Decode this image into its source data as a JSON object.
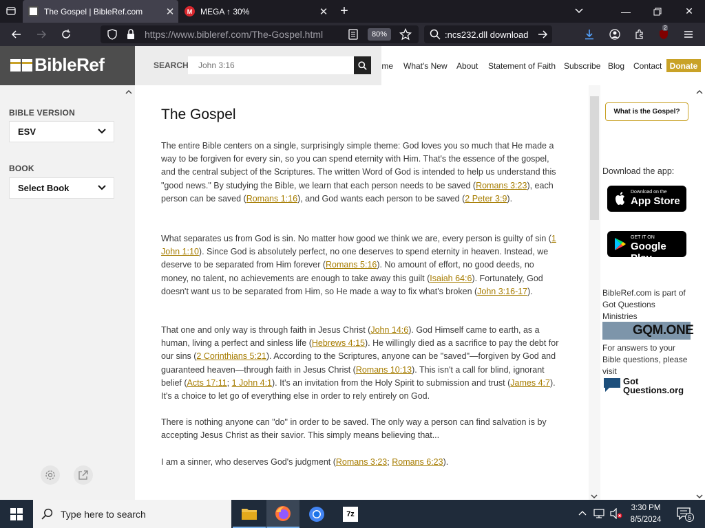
{
  "browser": {
    "tabs": [
      {
        "title": "The Gospel | BibleRef.com",
        "favicon": "bibleref-favicon",
        "active": true
      },
      {
        "title": "MEGA ↑ 30%",
        "favicon": "mega-favicon",
        "active": false
      }
    ],
    "url_domain": "https://www.bibleref.com",
    "url_path": "/The-Gospel.html",
    "zoom": "80%",
    "search_text": ":ncs232.dll download",
    "extension_badge": "2"
  },
  "site": {
    "logo": "BibleRef",
    "search_label": "SEARCH",
    "search_placeholder": "John 3:16",
    "nav": [
      "Home",
      "What's New",
      "About",
      "Statement of Faith",
      "Subscribe",
      "Blog",
      "Contact"
    ],
    "donate": "Donate",
    "accent_color": "#c9a227"
  },
  "sidebar": {
    "bible_version_label": "BIBLE VERSION",
    "bible_version_value": "ESV",
    "book_label": "BOOK",
    "book_value": "Select Book"
  },
  "article": {
    "title": "The Gospel",
    "p1": [
      "The entire Bible centers on a single, surprisingly simple theme: God loves you so much that He made a way to be forgiven for every sin, so you can spend eternity with Him. That's the essence of the gospel, and the central subject of the Scriptures. The written Word of God is intended to help us understand this \"good news.\" By studying the Bible, we learn that each person needs to be saved (",
      "Romans 3:23",
      "), each person can be saved (",
      "Romans 1:16",
      "), and God wants each person to be saved (",
      "2 Peter 3:9",
      ")."
    ],
    "p2": [
      "What separates us from God is sin. No matter how good we think we are, every person is guilty of sin (",
      "1 John 1:10",
      "). Since God is absolutely perfect, no one deserves to spend eternity in heaven. Instead, we deserve to be separated from Him forever (",
      "Romans 5:16",
      "). No amount of effort, no good deeds, no money, no talent, no achievements are enough to take away this guilt (",
      "Isaiah 64:6",
      "). Fortunately, God doesn't want us to be separated from Him, so He made a way to fix what's broken (",
      "John 3:16-17",
      ")."
    ],
    "p3": [
      "That one and only way is through faith in Jesus Christ (",
      "John 14:6",
      "). God Himself came to earth, as a human, living a perfect and sinless life (",
      "Hebrews 4:15",
      "). He willingly died as a sacrifice to pay the debt for our sins (",
      "2 Corinthians 5:21",
      "). According to the Scriptures, anyone can be \"saved\"—forgiven by God and guaranteed heaven—through faith in Jesus Christ (",
      "Romans 10:13",
      "). This isn't a call for blind, ignorant belief (",
      "Acts 17:11",
      "; ",
      "1 John 4:1",
      "). It's an invitation from the Holy Spirit to submission and trust (",
      "James 4:7",
      "). It's a choice to let go of everything else in order to rely entirely on God."
    ],
    "p4": "There is nothing anyone can \"do\" in order to be saved. The only way a person can find salvation is by accepting Jesus Christ as their savior. This simply means believing that...",
    "p5": [
      "I am a sinner, who deserves God's judgment (",
      "Romans 3:23",
      "; ",
      "Romans 6:23",
      ")."
    ]
  },
  "right": {
    "gospel_button": "What is the Gospel?",
    "download_label": "Download the app:",
    "appstore_small": "Download on the",
    "appstore_big": "App Store",
    "googleplay_small": "GET IT ON",
    "googleplay_big": "Google Play",
    "part_of": "BibleRef.com is part of Got Questions Ministries",
    "gqm_logo": "GQM.ONE",
    "answers": "For answers to your Bible questions, please visit",
    "gotquestions_logo": "Got Questions.org"
  },
  "taskbar": {
    "search_placeholder": "Type here to search",
    "time": "3:30 PM",
    "date": "8/5/2024",
    "notification_count": "5"
  }
}
